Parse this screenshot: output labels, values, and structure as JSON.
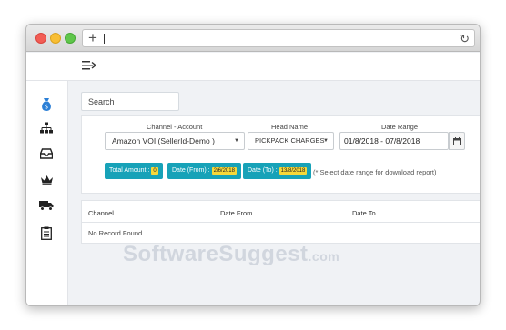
{
  "browser": {
    "newtab_symbol": "+",
    "reload_symbol": "↻"
  },
  "topbar": {
    "menu_icon": "menu-arrow-icon"
  },
  "sidebar": {
    "items": [
      {
        "icon": "money-bag-icon",
        "color": "#2b7fd6"
      },
      {
        "icon": "sitemap-icon"
      },
      {
        "icon": "inbox-icon"
      },
      {
        "icon": "crown-icon"
      },
      {
        "icon": "truck-icon"
      },
      {
        "icon": "clipboard-icon"
      }
    ]
  },
  "search": {
    "placeholder": "Search"
  },
  "filters": {
    "channel_account_label": "Channel - Account",
    "channel_account_value": "Amazon VOI (SellerId-Demo )",
    "head_name_label": "Head Name",
    "head_name_value": "PICKPACK CHARGES",
    "date_range_label": "Date Range",
    "date_range_value": "01/8/2018 - 07/8/2018",
    "chips": {
      "total_amount_label": "Total Amount :",
      "total_amount_value": "0",
      "date_from_label": "Date (From) :",
      "date_from_value": "2/6/2018",
      "date_to_label": "Date (To) :",
      "date_to_value": "13/8/2018"
    },
    "note": "(* Select date range for download report)"
  },
  "table": {
    "headers": [
      "Channel",
      "Date From",
      "Date To"
    ],
    "empty_text": "No Record Found"
  },
  "watermark": {
    "text": "SoftwareSuggest",
    "domain": ".com"
  },
  "colors": {
    "chip": "#17a2b8",
    "badge": "#f7d83a"
  }
}
